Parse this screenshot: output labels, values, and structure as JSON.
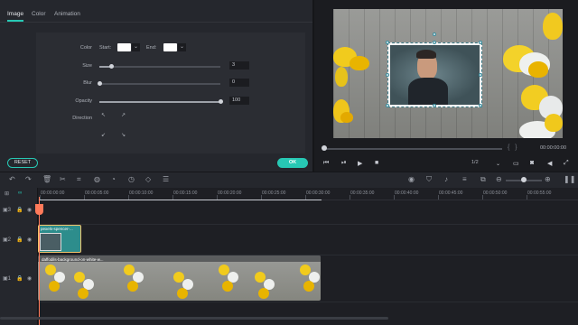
{
  "tabs": [
    {
      "label": "Image",
      "active": true
    },
    {
      "label": "Color",
      "active": false
    },
    {
      "label": "Animation",
      "active": false
    }
  ],
  "props": {
    "color_label": "Color",
    "start_label": "Start:",
    "end_label": "End:",
    "start_color": "#ffffff",
    "end_color": "#ffffff",
    "size_label": "Size",
    "size_value": "3",
    "size_level": 0.1,
    "blur_label": "Blur",
    "blur_value": "0",
    "blur_level": 0.0,
    "opacity_label": "Opacity",
    "opacity_value": "100",
    "opacity_level": 1.0,
    "direction_label": "Direction"
  },
  "buttons": {
    "reset": "RESET",
    "ok": "OK"
  },
  "player": {
    "time": "00:00:00:00",
    "ratio": "1/2",
    "progress": 0.0
  },
  "ruler": {
    "ticks": [
      "00:00:00:00",
      "00:00:05:00",
      "00:00:10:00",
      "00:00:15:00",
      "00:00:20:00",
      "00:00:25:00",
      "00:00:30:00",
      "00:00:35:00",
      "00:00:40:00",
      "00:00:45:00",
      "00:00:50:00",
      "00:00:55:00"
    ]
  },
  "tracks": {
    "clip1_name": "pexels-spencer-...",
    "clip2_name": "daffodils-background-on-white-w..."
  },
  "colors": {
    "accent": "#27c8b4",
    "playhead": "#ff7a5a",
    "clip_highlight": "#f2c46b"
  }
}
